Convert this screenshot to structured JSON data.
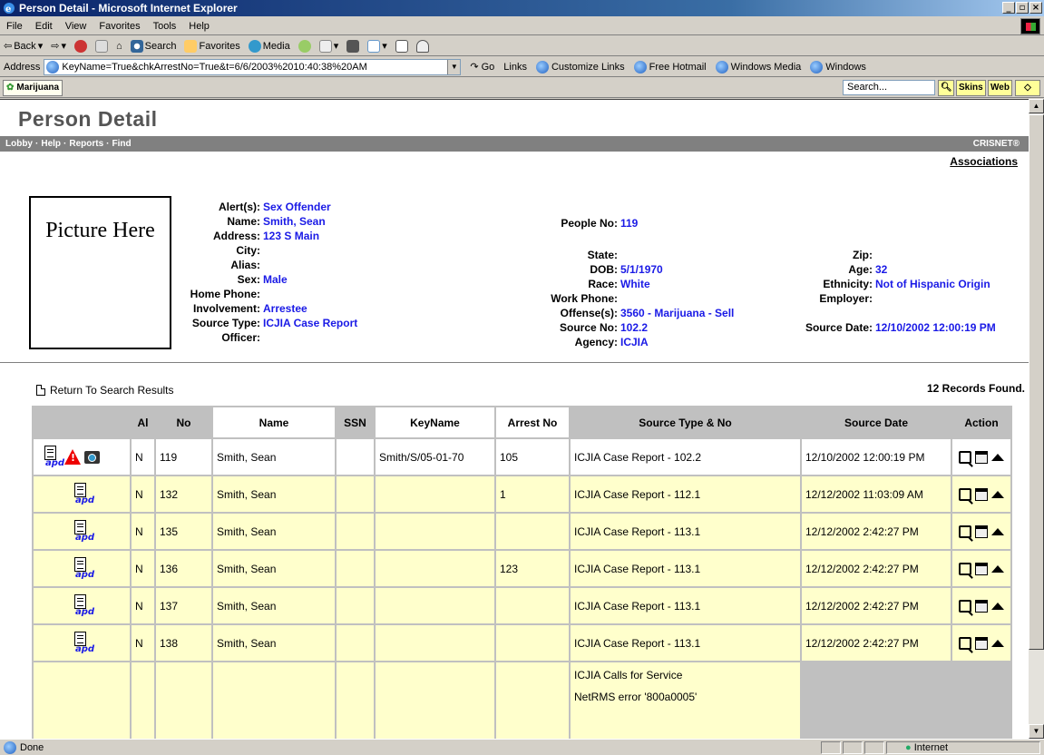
{
  "window": {
    "title": "Person Detail - Microsoft Internet Explorer",
    "controls": [
      "_",
      "×"
    ]
  },
  "menu": [
    "File",
    "Edit",
    "View",
    "Favorites",
    "Tools",
    "Help"
  ],
  "toolbar": {
    "back": "Back",
    "search": "Search",
    "favorites": "Favorites",
    "media": "Media"
  },
  "address": {
    "label": "Address",
    "url": "KeyName=True&chkArrestNo=True&t=6/6/2003%2010:40:38%20AM",
    "go": "Go",
    "links_label": "Links",
    "links": [
      "Customize Links",
      "Free Hotmail",
      "Windows Media",
      "Windows"
    ]
  },
  "linkbar": {
    "marijuana": "Marijuana",
    "search_placeholder": "Search...",
    "skins": "Skins",
    "web": "Web"
  },
  "page": {
    "title": "Person Detail",
    "nav": [
      "Lobby",
      "Help",
      "Reports",
      "Find"
    ],
    "brand": "CRISNET®",
    "associations": "Associations",
    "picture": "Picture Here"
  },
  "person": {
    "alerts": {
      "label": "Alert(s):",
      "value": "Sex Offender"
    },
    "name": {
      "label": "Name:",
      "value": "Smith, Sean"
    },
    "address": {
      "label": "Address:",
      "value": "123 S Main"
    },
    "city": {
      "label": "City:",
      "value": ""
    },
    "alias": {
      "label": "Alias:",
      "value": ""
    },
    "sex": {
      "label": "Sex:",
      "value": "Male"
    },
    "home_phone": {
      "label": "Home Phone:",
      "value": ""
    },
    "involvement": {
      "label": "Involvement:",
      "value": "Arrestee"
    },
    "source_type": {
      "label": "Source Type:",
      "value": "ICJIA Case Report"
    },
    "officer": {
      "label": "Officer:",
      "value": ""
    },
    "people_no": {
      "label": "People No:",
      "value": "119"
    },
    "state": {
      "label": "State:",
      "value": ""
    },
    "dob": {
      "label": "DOB:",
      "value": "5/1/1970"
    },
    "race": {
      "label": "Race:",
      "value": "White"
    },
    "work_phone": {
      "label": "Work Phone:",
      "value": ""
    },
    "offenses": {
      "label": "Offense(s):",
      "value": "3560 - Marijuana - Sell"
    },
    "source_no": {
      "label": "Source No:",
      "value": "102.2"
    },
    "agency": {
      "label": "Agency:",
      "value": "ICJIA"
    },
    "zip": {
      "label": "Zip:",
      "value": ""
    },
    "age": {
      "label": "Age:",
      "value": "32"
    },
    "ethnicity": {
      "label": "Ethnicity:",
      "value": "Not of Hispanic Origin"
    },
    "employer": {
      "label": "Employer:",
      "value": ""
    },
    "source_date": {
      "label": "Source Date:",
      "value": "12/10/2002 12:00:19 PM"
    }
  },
  "results": {
    "return_link": "Return To Search Results",
    "count": "12 Records Found.",
    "columns": [
      "",
      "Al",
      "No",
      "Name",
      "SSN",
      "KeyName",
      "Arrest No",
      "Source Type & No",
      "Source Date",
      "Action"
    ],
    "icon_text": "apd",
    "rows": [
      {
        "al": "N",
        "no": "119",
        "name": "Smith, Sean",
        "ssn": "",
        "keyname": "Smith/S/05-01-70",
        "arrest_no": "105",
        "source": "ICJIA Case Report - 102.2",
        "date": "12/10/2002 12:00:19 PM"
      },
      {
        "al": "N",
        "no": "132",
        "name": "Smith, Sean",
        "ssn": "",
        "keyname": "",
        "arrest_no": "1",
        "source": "ICJIA Case Report - 112.1",
        "date": "12/12/2002 11:03:09 AM"
      },
      {
        "al": "N",
        "no": "135",
        "name": "Smith, Sean",
        "ssn": "",
        "keyname": "",
        "arrest_no": "",
        "source": "ICJIA Case Report - 113.1",
        "date": "12/12/2002 2:42:27 PM"
      },
      {
        "al": "N",
        "no": "136",
        "name": "Smith, Sean",
        "ssn": "",
        "keyname": "",
        "arrest_no": "123",
        "source": "ICJIA Case Report - 113.1",
        "date": "12/12/2002 2:42:27 PM"
      },
      {
        "al": "N",
        "no": "137",
        "name": "Smith, Sean",
        "ssn": "",
        "keyname": "",
        "arrest_no": "",
        "source": "ICJIA Case Report - 113.1",
        "date": "12/12/2002 2:42:27 PM"
      },
      {
        "al": "N",
        "no": "138",
        "name": "Smith, Sean",
        "ssn": "",
        "keyname": "",
        "arrest_no": "",
        "source": "ICJIA Case Report - 113.1",
        "date": "12/12/2002 2:42:27 PM"
      }
    ],
    "partial_row": {
      "source_line1": "ICJIA Calls for Service",
      "source_line2": "NetRMS error '800a0005'"
    }
  },
  "status": {
    "text": "Done",
    "zone": "Internet"
  }
}
